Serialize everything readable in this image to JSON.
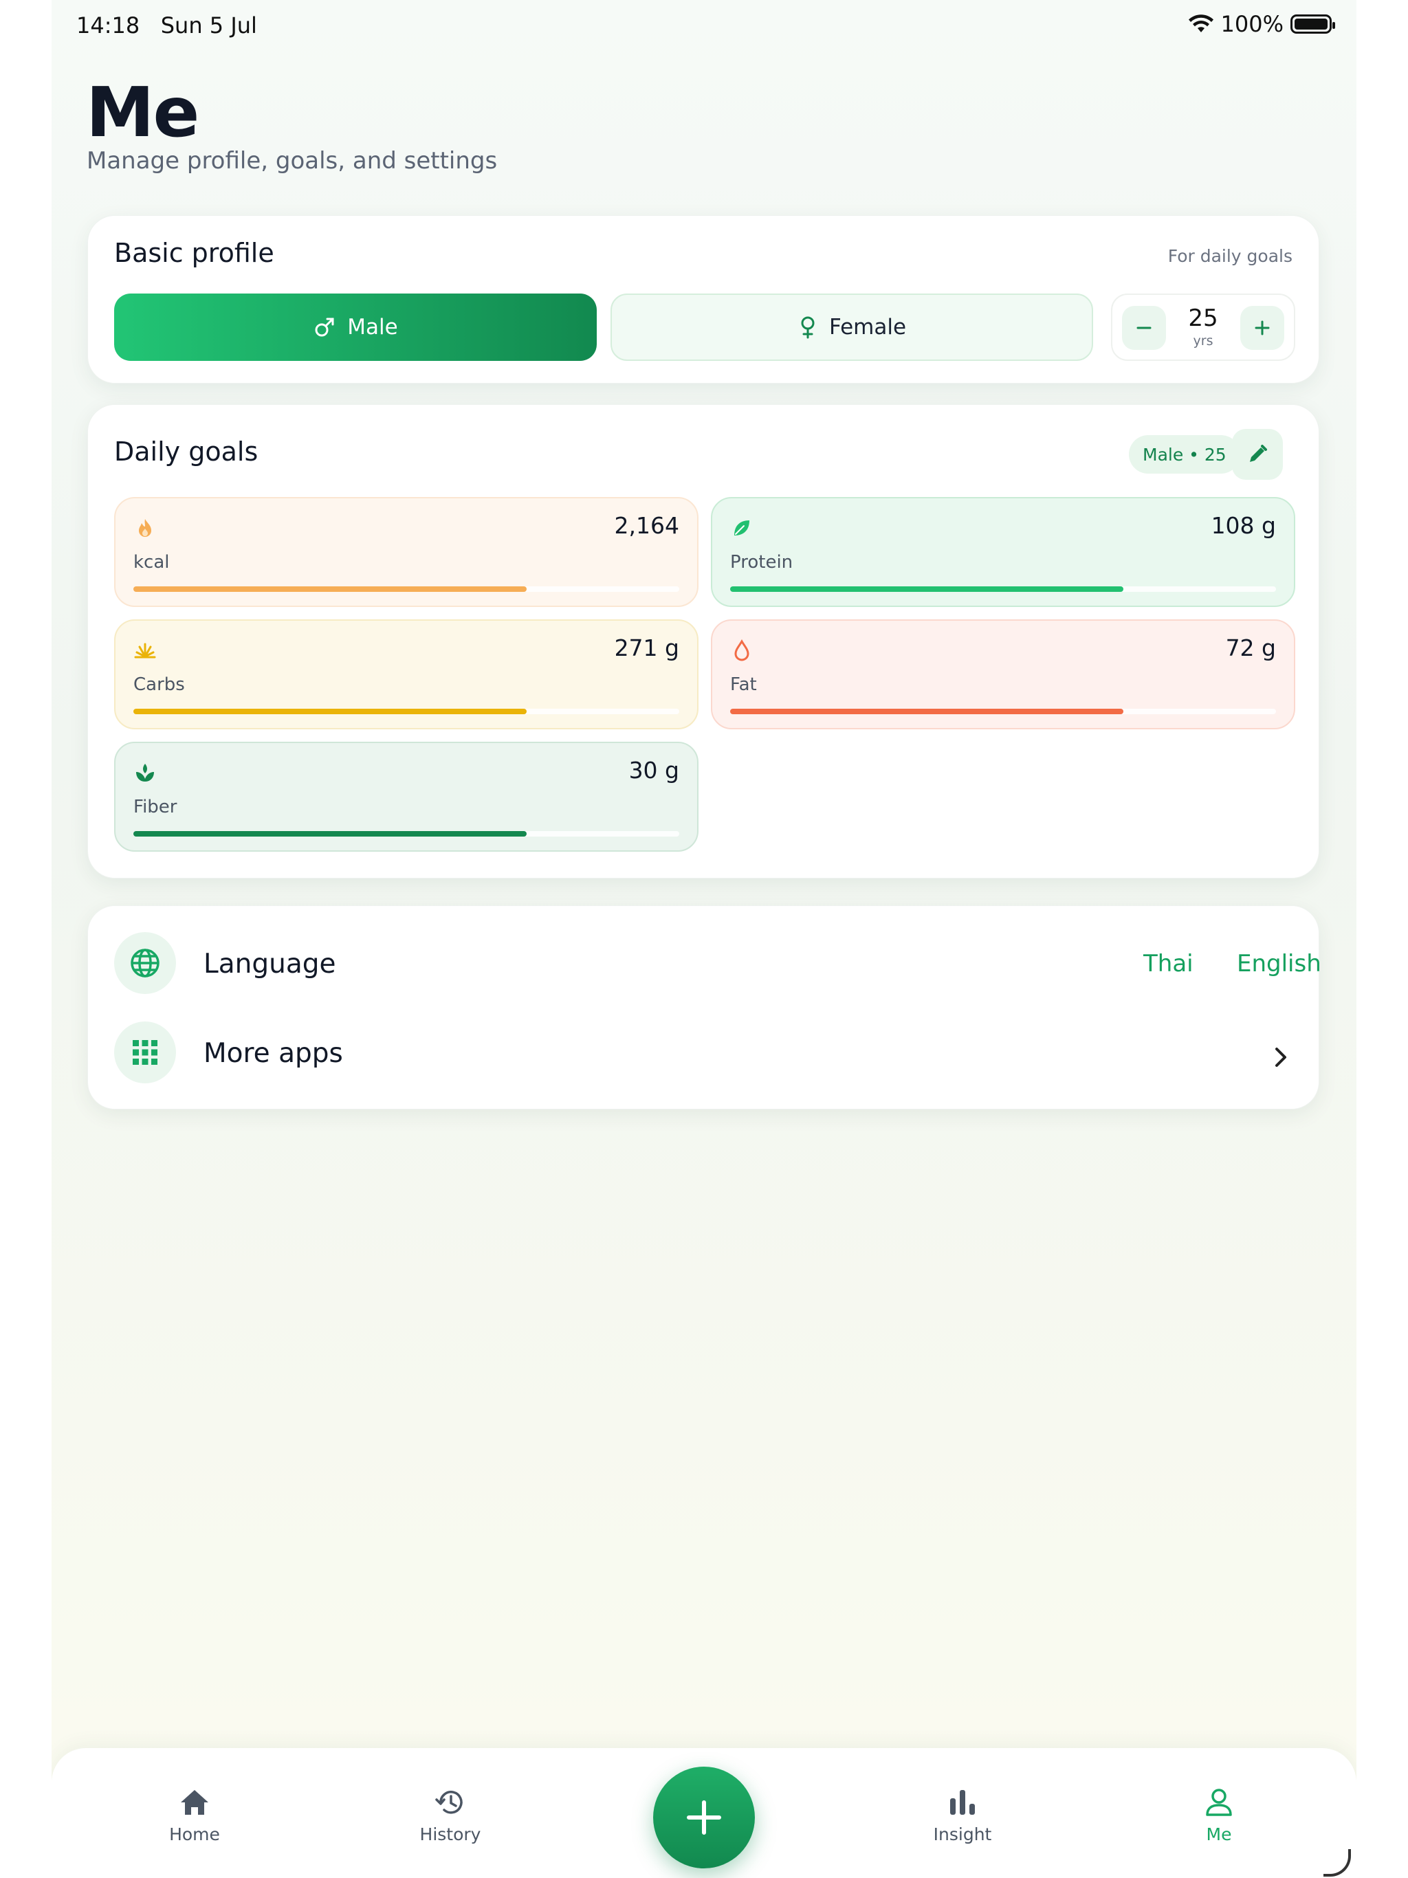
{
  "status_bar": {
    "time": "14:18",
    "date": "Sun 5 Jul",
    "battery": "100%"
  },
  "header": {
    "title": "Me",
    "subtitle": "Manage profile, goals, and settings"
  },
  "basic_profile": {
    "title": "Basic profile",
    "hint": "For daily goals",
    "gender_options": [
      {
        "label": "Male",
        "icon": "male-symbol-icon",
        "selected": true
      },
      {
        "label": "Female",
        "icon": "female-symbol-icon",
        "selected": false
      }
    ],
    "age": {
      "value": "25",
      "unit": "yrs"
    }
  },
  "daily_goals": {
    "title": "Daily goals",
    "profile_pill": "Male • 25",
    "items": [
      {
        "label": "kcal",
        "value": "2,164",
        "icon": "flame-icon",
        "progress": 0.72,
        "color": "#f6ad55",
        "bg": "#fef6ee",
        "border": "#fbe6d2"
      },
      {
        "label": "Protein",
        "value": "108 g",
        "icon": "leaf-icon",
        "progress": 0.72,
        "color": "#22c070",
        "bg": "#e9f8ef",
        "border": "#c9ecd6"
      },
      {
        "label": "Carbs",
        "value": "271 g",
        "icon": "wheat-icon",
        "progress": 0.72,
        "color": "#eab308",
        "bg": "#fdf8e8",
        "border": "#f7ebc4"
      },
      {
        "label": "Fat",
        "value": "72 g",
        "icon": "drop-icon",
        "progress": 0.72,
        "color": "#f26b45",
        "bg": "#fef1ee",
        "border": "#fbd8ce"
      },
      {
        "label": "Fiber",
        "value": "30 g",
        "icon": "sprout-icon",
        "progress": 0.72,
        "color": "#14884f",
        "bg": "#ebf5ef",
        "border": "#cfe6d8"
      }
    ]
  },
  "settings": {
    "language": {
      "label": "Language",
      "options": [
        "Thai",
        "English"
      ]
    },
    "more_apps": {
      "label": "More apps"
    }
  },
  "nav": {
    "items": [
      {
        "label": "Home",
        "icon": "home-icon",
        "active": false
      },
      {
        "label": "History",
        "icon": "history-icon",
        "active": false
      },
      {
        "label": "Insight",
        "icon": "bar-chart-icon",
        "active": false
      },
      {
        "label": "Me",
        "icon": "user-icon",
        "active": true
      }
    ],
    "accent": "#18a864"
  }
}
